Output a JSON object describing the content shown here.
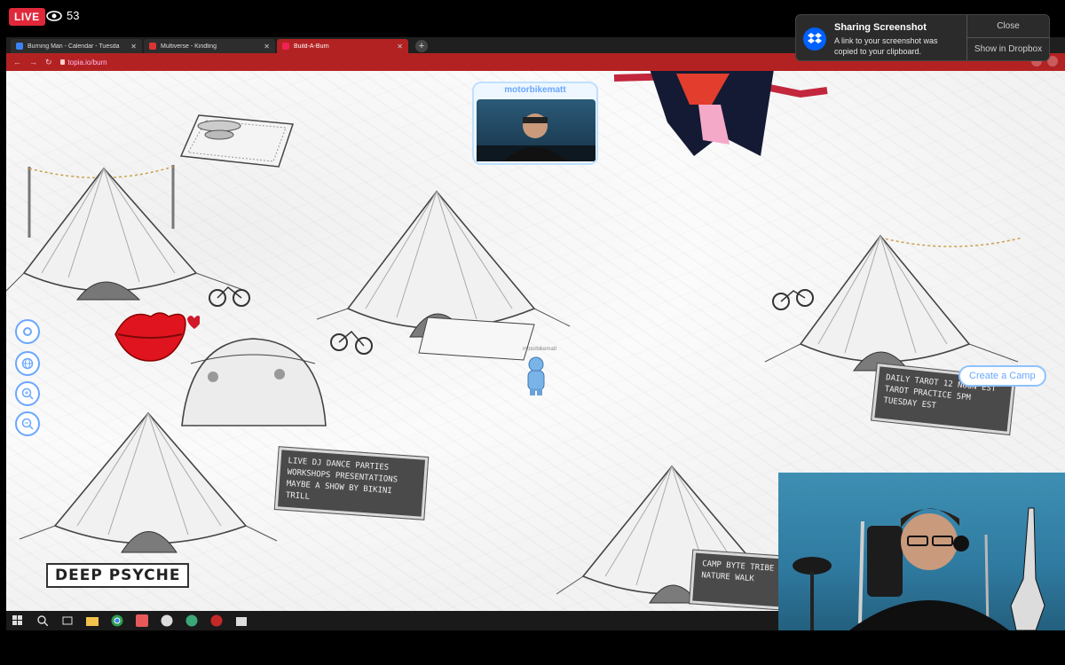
{
  "stream": {
    "live_label": "LIVE",
    "viewer_count": "53"
  },
  "browser": {
    "tabs": [
      {
        "label": "Burning Man - Calendar - Tuesda",
        "active": false
      },
      {
        "label": "Multiverse - Kindling",
        "active": false
      },
      {
        "label": "Build-A-Burn",
        "active": true
      }
    ],
    "new_tab": "+",
    "url": "topia.io/burn",
    "accent": "#b32222"
  },
  "map": {
    "participant_card": {
      "name": "motorbikematt"
    },
    "avatar_label": "motorbikematt",
    "signs": {
      "center": [
        "LIVE DJ DANCE PARTIES",
        "WORKSHOPS PRESENTATIONS",
        "MAYBE A SHOW BY BIKINI TRILL"
      ],
      "right": [
        "DAILY TAROT 12 NOON EST",
        "TAROT PRACTICE 5PM TUESDAY EST"
      ],
      "bottom": [
        "CAMP BYTE TRIBE",
        "NATURE WALK"
      ]
    },
    "camp_label": "DEEP PSYCHE",
    "create_camp_label": "Create a Camp",
    "controls": [
      "settings-icon",
      "globe-icon",
      "zoom-in-icon",
      "zoom-out-icon"
    ],
    "accent": "#6aa7ff"
  },
  "notification": {
    "title": "Sharing Screenshot",
    "body": "A link to your screenshot was copied to your clipboard.",
    "close_label": "Close",
    "show_label": "Show in Dropbox"
  }
}
